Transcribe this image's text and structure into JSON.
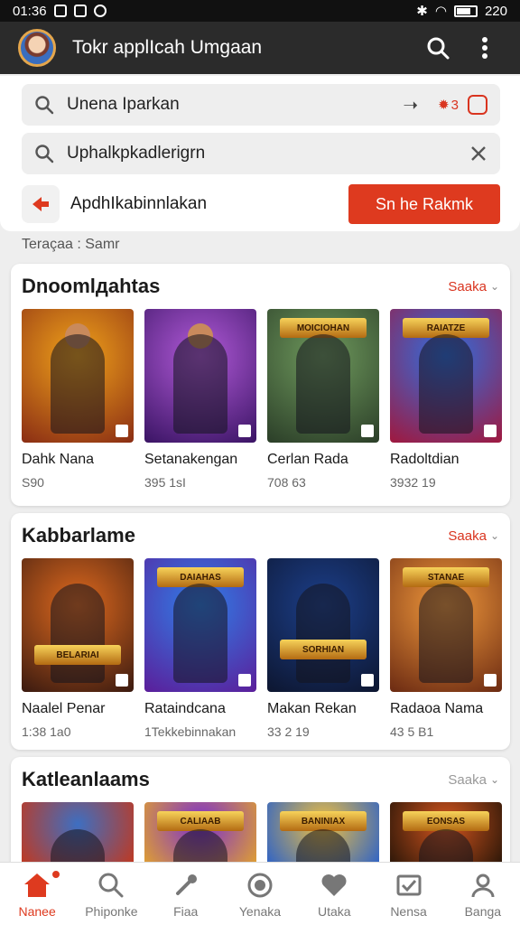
{
  "status": {
    "time": "01:36",
    "battery": "220"
  },
  "app": {
    "title": "Tokr applIcah Umgaan"
  },
  "search": {
    "primary_text": "Unena Iparkan",
    "badge_text": "3",
    "secondary_text": "Uphalkpkadlerigrn",
    "apply_label": "ApdhIkabinnlakan",
    "apply_button": "Sn he Rakmk"
  },
  "filter": {
    "text": "Teraçaa : Samr"
  },
  "sections": [
    {
      "title": "Dnoomlдahtas",
      "more": "Saaka",
      "games": [
        {
          "name": "Dahk Nana",
          "meta": "S90",
          "colors": [
            "#f0a21a",
            "#8a2d14"
          ],
          "banner": ""
        },
        {
          "name": "Setanakengan",
          "meta": "395 1sI",
          "colors": [
            "#b15ad8",
            "#3a1464"
          ],
          "banner": ""
        },
        {
          "name": "Cerlan Rada",
          "meta": "708 63",
          "colors": [
            "#6f9a5d",
            "#2b3e28"
          ],
          "banner": "MOICIOHAN"
        },
        {
          "name": "Radoltdian",
          "meta": "3932 19",
          "colors": [
            "#2e6fe0",
            "#a0183e"
          ],
          "banner": "RAIATZE"
        }
      ]
    },
    {
      "title": "Kabbarlame",
      "more": "Saaka",
      "games": [
        {
          "name": "Naalel Penar",
          "meta": "1:38 1a0",
          "colors": [
            "#e06a1e",
            "#3a1a10"
          ],
          "banner": "BELARIAI"
        },
        {
          "name": "Rataindcana",
          "meta": "1Tekkebinnakan",
          "colors": [
            "#2f7fe8",
            "#5b1e9a"
          ],
          "banner": "DAIAHAS"
        },
        {
          "name": "Makan Rekan",
          "meta": "33 2 19",
          "colors": [
            "#1c3f8a",
            "#0d1630"
          ],
          "banner": "SORHIAN"
        },
        {
          "name": "Radaoa Nama",
          "meta": "43 5 B1",
          "colors": [
            "#f29a3c",
            "#6b2a12"
          ],
          "banner": "STANAE"
        }
      ]
    },
    {
      "title": "Katleanlaams",
      "more": "Saaka",
      "games": [
        {
          "name": "",
          "meta": "",
          "colors": [
            "#3d6fc2",
            "#c2381e"
          ],
          "banner": ""
        },
        {
          "name": "",
          "meta": "",
          "colors": [
            "#7b2fd0",
            "#e0a030"
          ],
          "banner": "CALIAAB"
        },
        {
          "name": "",
          "meta": "",
          "colors": [
            "#f0c040",
            "#2c62c8"
          ],
          "banner": "BANINIAX"
        },
        {
          "name": "",
          "meta": "",
          "colors": [
            "#d4551e",
            "#2a1608"
          ],
          "banner": "EONSAS"
        }
      ]
    }
  ],
  "nav": [
    {
      "label": "Nanee",
      "icon": "home-icon",
      "active": true
    },
    {
      "label": "Phiponke",
      "icon": "search-icon",
      "active": false
    },
    {
      "label": "Fiaa",
      "icon": "tool-icon",
      "active": false
    },
    {
      "label": "Yenaka",
      "icon": "circle-icon",
      "active": false
    },
    {
      "label": "Utaka",
      "icon": "heart-icon",
      "active": false
    },
    {
      "label": "Nensa",
      "icon": "mail-icon",
      "active": false
    },
    {
      "label": "Banga",
      "icon": "person-icon",
      "active": false
    }
  ],
  "colors": {
    "accent": "#de3a1f",
    "app_bar": "#2b2b2b",
    "status_bar": "#111111"
  }
}
